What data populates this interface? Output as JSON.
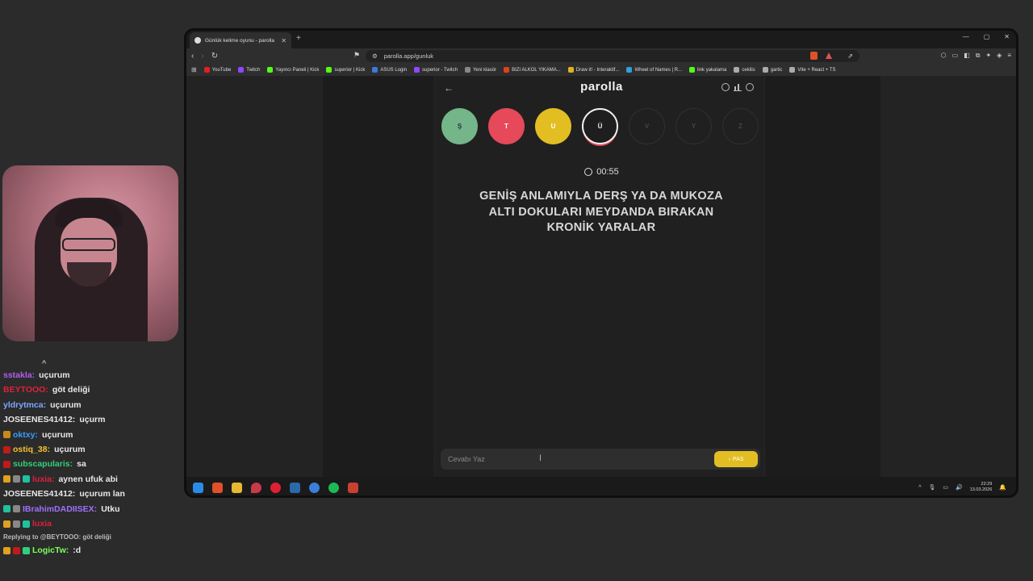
{
  "chat": [
    {
      "user": "sstakla",
      "text": "uçurum",
      "color": "#b45cf0",
      "badges": []
    },
    {
      "user": "BEYTOOO",
      "text": "göt deliği",
      "color": "#e0203c",
      "badges": []
    },
    {
      "user": "yldrytmca",
      "text": "uçurum",
      "color": "#7aa7ff",
      "badges": []
    },
    {
      "user": "JOSEENES41412",
      "text": "uçurm",
      "color": "#e8e8e8",
      "badges": []
    },
    {
      "user": "oktxy",
      "text": "uçurum",
      "color": "#3a9cff",
      "badges": [
        "#c78a1a"
      ]
    },
    {
      "user": "ostiq_38",
      "text": "uçurum",
      "color": "#f2c230",
      "badges": [
        "#c01a1a"
      ]
    },
    {
      "user": "subscapularis",
      "text": "sa",
      "color": "#30d07a",
      "badges": [
        "#c01a1a"
      ]
    },
    {
      "user": "luxia",
      "text": "aynen ufuk abi",
      "color": "#e0203c",
      "badges": [
        "#e0a020",
        "#888888",
        "#20c0a0"
      ]
    },
    {
      "user": "JOSEENES41412",
      "text": "uçurum lan",
      "color": "#e8e8e8",
      "badges": []
    },
    {
      "user": "IBrahimDADIISEX",
      "text": "Utku",
      "color": "#a070ff",
      "badges": [
        "#20c0a0",
        "#888888"
      ]
    },
    {
      "user": "luxia",
      "text": "",
      "color": "#e0203c",
      "badges": [
        "#e0a020",
        "#888888",
        "#20c0a0"
      ]
    },
    {
      "user": "LogicTw",
      "text": ":d",
      "color": "#7dff5a",
      "badges": [
        "#e0a020",
        "#c01a1a",
        "#30d07a"
      ]
    }
  ],
  "chat_reply": "Replying to @BEYTOOO: göt deliği",
  "browser": {
    "tab_title": "Günlük kelime oyunu - parolla",
    "url": "parolla.app/gunluk",
    "bookmarks": [
      {
        "label": "YouTube",
        "color": "#e02020"
      },
      {
        "label": "Twitch",
        "color": "#9146ff"
      },
      {
        "label": "Yayıncı Paneli | Kick",
        "color": "#53fc18"
      },
      {
        "label": "superior | Kick",
        "color": "#53fc18"
      },
      {
        "label": "ASUS Login",
        "color": "#3a7bd5"
      },
      {
        "label": "superior - Twitch",
        "color": "#9146ff"
      },
      {
        "label": "Yeni klasör",
        "color": "#888888"
      },
      {
        "label": "BIZI ALKOL YIKAMA...",
        "color": "#e04020"
      },
      {
        "label": "Draw it! - Interaktif...",
        "color": "#e0b020"
      },
      {
        "label": "Wheel of Names | R...",
        "color": "#30a0e0"
      },
      {
        "label": "link yakalama",
        "color": "#53fc18"
      },
      {
        "label": "cekilis",
        "color": "#aaaaaa"
      },
      {
        "label": "gartic",
        "color": "#aaaaaa"
      },
      {
        "label": "Vite + React + TS",
        "color": "#aaaaaa"
      }
    ]
  },
  "app": {
    "logo": "parolla",
    "letters": [
      {
        "char": "Ş",
        "state": "correct"
      },
      {
        "char": "T",
        "state": "wrong"
      },
      {
        "char": "U",
        "state": "passed"
      },
      {
        "char": "Ü",
        "state": "active"
      },
      {
        "char": "V",
        "state": "empty"
      },
      {
        "char": "Y",
        "state": "empty"
      },
      {
        "char": "Z",
        "state": "empty"
      }
    ],
    "timer": "00:55",
    "question": "GENİŞ ANLAMIYLA DERŞ YA DA MUKOZA ALTI DOKULARI MEYDANDA BIRAKAN KRONİK YARALAR",
    "answer_placeholder": "Cevabı Yaz",
    "pass_label": "PAS",
    "colors": {
      "correct": "#74b58a",
      "wrong": "#e5495a",
      "passed": "#e2be22"
    }
  },
  "taskbar": {
    "time": "22:29",
    "date": "13.03.2026"
  }
}
